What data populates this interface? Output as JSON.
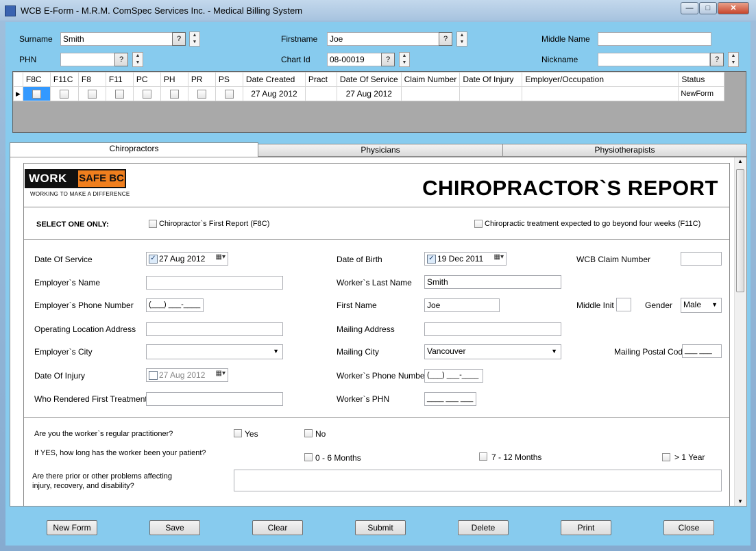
{
  "window": {
    "title": "WCB E-Form - M.R.M. ComSpec Services Inc. - Medical Billing System"
  },
  "search": {
    "surname_label": "Surname",
    "surname_value": "Smith",
    "firstname_label": "Firstname",
    "firstname_value": "Joe",
    "middle_label": "Middle Name",
    "middle_value": "",
    "phn_label": "PHN",
    "phn_value": "",
    "chart_label": "Chart Id",
    "chart_value": "08-00019",
    "nickname_label": "Nickname",
    "nickname_value": "",
    "query_btn": "?"
  },
  "grid": {
    "headers": [
      "F8C",
      "F11C",
      "F8",
      "F11",
      "PC",
      "PH",
      "PR",
      "PS",
      "Date Created",
      "Pract",
      "Date Of Service",
      "Claim Number",
      "Date Of Injury",
      "Employer/Occupation",
      "Status"
    ],
    "row": {
      "date_created": "27 Aug 2012",
      "pract": "",
      "date_of_service": "27 Aug 2012",
      "claim_number": "",
      "date_of_injury": "",
      "employer": "",
      "status": "NewForm"
    }
  },
  "tabs": [
    "Chiropractors",
    "Physicians",
    "Physiotherapists"
  ],
  "logo": {
    "work": "WORK",
    "safe": "SAFE BC",
    "tagline": "WORKING TO MAKE A DIFFERENCE"
  },
  "report": {
    "title": "CHIROPRACTOR`S REPORT",
    "select_one": "SELECT ONE ONLY:",
    "opt_f8c": "Chiropractor`s First Report (F8C)",
    "opt_f11c": "Chiropractic treatment expected to go beyond four weeks (F11C)"
  },
  "form": {
    "date_of_service_label": "Date Of Service",
    "date_of_service": "27 Aug 2012",
    "employer_name_label": "Employer`s Name",
    "employer_phone_label": "Employer`s Phone Number",
    "phone_mask": "(___) ___-____",
    "op_location_label": "Operating Location Address",
    "employer_city_label": "Employer`s City",
    "date_of_injury_label": "Date Of Injury",
    "date_of_injury": "27 Aug 2012",
    "who_rendered_label": "Who Rendered First Treatment",
    "dob_label": "Date of Birth",
    "dob": "19 Dec 2011",
    "worker_last_label": "Worker`s Last Name",
    "worker_last": "Smith",
    "first_name_label": "First Name",
    "first_name": "Joe",
    "mailing_address_label": "Mailing Address",
    "mailing_city_label": "Mailing City",
    "mailing_city": "Vancouver",
    "worker_phone_label": "Worker`s Phone Number",
    "worker_phn_label": "Worker`s PHN",
    "phn_mask": "____ ___ ___",
    "wcb_claim_label": "WCB Claim Number",
    "middle_init_label": "Middle Init",
    "gender_label": "Gender",
    "gender": "Male",
    "postal_label": "Mailing Postal Code",
    "postal_mask": "___ ___"
  },
  "questions": {
    "q1": "Are you the worker`s regular practitioner?",
    "yes": "Yes",
    "no": "No",
    "q2": "If YES, how long has the worker been your patient?",
    "opt1": "0 - 6 Months",
    "opt2": "7 - 12 Months",
    "opt3": "> 1 Year",
    "q3_line1": "Are there prior or other problems affecting",
    "q3_line2": "injury, recovery, and disability?"
  },
  "buttons": {
    "new_form": "New Form",
    "save": "Save",
    "clear": "Clear",
    "submit": "Submit",
    "delete": "Delete",
    "print": "Print",
    "close": "Close"
  }
}
